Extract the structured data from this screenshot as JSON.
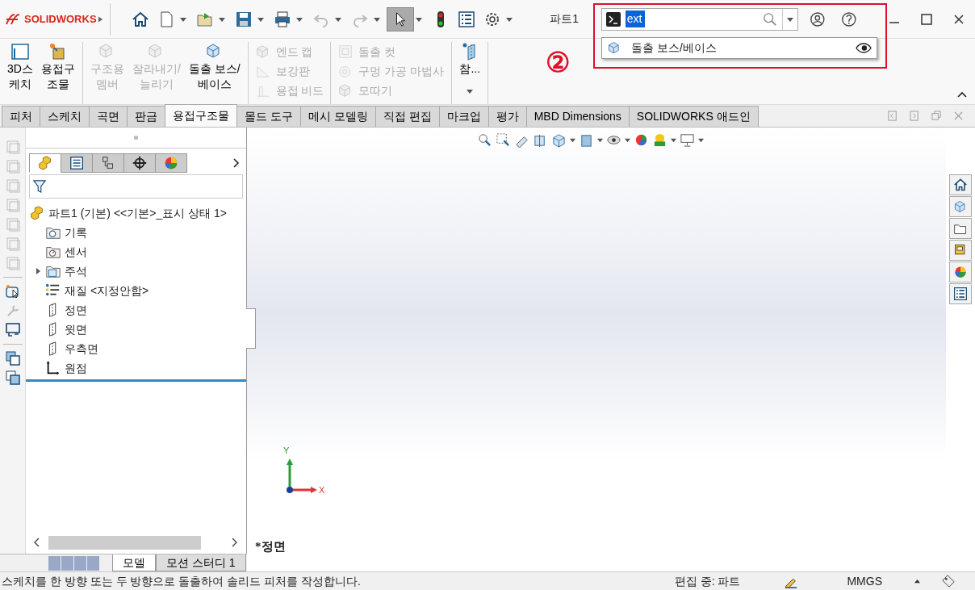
{
  "app": {
    "logo": "SOLIDWORKS",
    "document_title": "파트1"
  },
  "search": {
    "value": "ext",
    "suggestions": [
      {
        "label": "돌출 보스/베이스"
      }
    ]
  },
  "annotation": {
    "label": "②"
  },
  "ribbon": {
    "groups": [
      {
        "kind": "large",
        "items": [
          {
            "lines": [
              "3D스",
              "케치"
            ],
            "disabled": false
          },
          {
            "lines": [
              "용접구",
              "조물"
            ],
            "disabled": false
          }
        ]
      },
      {
        "kind": "large",
        "items": [
          {
            "lines": [
              "구조용",
              "멤버"
            ],
            "disabled": true
          },
          {
            "lines": [
              "잘라내기/",
              "늘리기"
            ],
            "disabled": true
          },
          {
            "lines": [
              "돌출 보스/",
              "베이스"
            ],
            "disabled": false
          }
        ]
      },
      {
        "kind": "small",
        "items": [
          {
            "lines": [
              "엔드 캡"
            ],
            "disabled": true
          },
          {
            "lines": [
              "보강판"
            ],
            "disabled": true
          },
          {
            "lines": [
              "용접 비드"
            ],
            "disabled": true
          }
        ]
      },
      {
        "kind": "small",
        "items": [
          {
            "lines": [
              "돌출 컷"
            ],
            "disabled": true
          },
          {
            "lines": [
              "구멍 가공 마법사"
            ],
            "disabled": true
          },
          {
            "lines": [
              "모따기"
            ],
            "disabled": true
          }
        ]
      },
      {
        "kind": "large",
        "items": [
          {
            "lines": [
              "참..."
            ],
            "disabled": false
          }
        ]
      }
    ]
  },
  "tabs": [
    {
      "label": "피처",
      "selected": false
    },
    {
      "label": "스케치",
      "selected": false
    },
    {
      "label": "곡면",
      "selected": false
    },
    {
      "label": "판금",
      "selected": false
    },
    {
      "label": "용접구조물",
      "selected": true
    },
    {
      "label": "몰드 도구",
      "selected": false
    },
    {
      "label": "메시 모델링",
      "selected": false
    },
    {
      "label": "직접 편집",
      "selected": false
    },
    {
      "label": "마크업",
      "selected": false
    },
    {
      "label": "평가",
      "selected": false
    },
    {
      "label": "MBD Dimensions",
      "selected": false
    },
    {
      "label": "SOLIDWORKS 애드인",
      "selected": false
    }
  ],
  "panel_tabs": [
    {
      "selected": true
    },
    {
      "selected": false
    },
    {
      "selected": false
    },
    {
      "selected": false
    },
    {
      "selected": false
    }
  ],
  "tree": {
    "label": "파트1 (기본) <<기본>_표시 상태 1>",
    "children": [
      {
        "label": "기록"
      },
      {
        "label": "센서"
      },
      {
        "label": "주석",
        "expanded": false
      },
      {
        "label": "재질 <지정안함>"
      },
      {
        "label": "정면"
      },
      {
        "label": "윗면"
      },
      {
        "label": "우측면"
      },
      {
        "label": "원점"
      }
    ]
  },
  "bottom_tabs": [
    {
      "label": "모델",
      "selected": true
    },
    {
      "label": "모션 스터디 1",
      "selected": false
    }
  ],
  "viewport": {
    "view_name": "*정면",
    "axis_y": "Y",
    "axis_x": "X"
  },
  "status_bar": {
    "message": "스케치를 한 방향 또는 두 방향으로 돌출하여 솔리드 피처를 작성합니다.",
    "mode": "편집 중: 파트",
    "units": "MMGS"
  }
}
